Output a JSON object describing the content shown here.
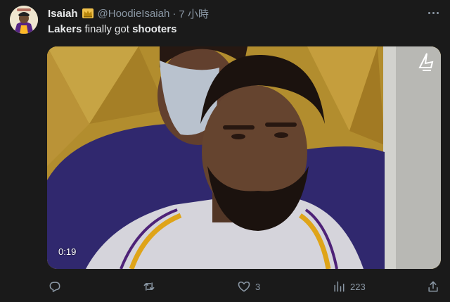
{
  "tweet": {
    "author": {
      "display_name": "Isaiah",
      "badge_icon": "crown-icon",
      "handle": "@HoodieIsaiah",
      "separator": "·",
      "time": "7 小時"
    },
    "text": {
      "part1": "Lakers",
      "part2": " finally got ",
      "part3": "shooters"
    },
    "media": {
      "type": "video",
      "duration": "0:19",
      "watermark_icon": "lakers-logo-icon"
    },
    "actions": {
      "reply": {
        "icon": "reply-icon",
        "count": ""
      },
      "retweet": {
        "icon": "retweet-icon",
        "count": ""
      },
      "like": {
        "icon": "heart-icon",
        "count": "3"
      },
      "views": {
        "icon": "views-icon",
        "count": "223"
      },
      "share": {
        "icon": "share-icon",
        "count": ""
      }
    }
  },
  "colors": {
    "background": "#1a1a1a",
    "text_primary": "#e7e9ea",
    "text_secondary": "#8b98a5",
    "crown": "#e8b93a",
    "lakers_purple": "#3a2d7a",
    "lakers_gold": "#f2b21b"
  }
}
